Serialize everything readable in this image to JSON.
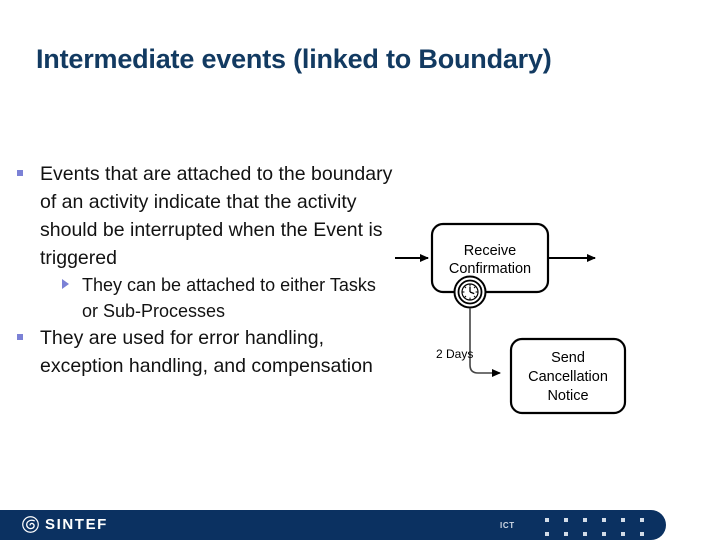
{
  "slide": {
    "title": "Intermediate events (linked to Boundary)",
    "title_color": "#123a61",
    "background_color": "#ffffff"
  },
  "body": {
    "bullets": [
      {
        "level": 1,
        "marker": "square-bullet",
        "text": "Events that are attached to the boundary of an activity indicate that the activity should be interrupted when the Event is triggered"
      },
      {
        "level": 2,
        "marker": "triangle-bullet",
        "text": "They can be attached to either Tasks or Sub-Processes"
      },
      {
        "level": 1,
        "marker": "square-bullet",
        "text": "They are used for error handling, exception handling, and compensation"
      }
    ],
    "bullet_color": "#7b81d6",
    "text_color": "#121212"
  },
  "diagram": {
    "type": "bpmn-process-fragment",
    "tasks": [
      {
        "id": "receive",
        "label_lines": [
          "Receive",
          "Confirmation"
        ]
      },
      {
        "id": "send",
        "label_lines": [
          "Send",
          "Cancellation",
          "Notice"
        ]
      }
    ],
    "boundary_event": {
      "attached_to": "receive",
      "event_type": "timer",
      "icon": "clock-icon"
    },
    "flow_labels": [
      {
        "id": "timer-flow",
        "text": "2 Days"
      }
    ],
    "incoming_arrow": true,
    "outgoing_arrow": true,
    "stroke_color": "#000000",
    "fill_color": "#ffffff"
  },
  "footer": {
    "bar_color": "#0b3161",
    "logo_text": "SINTEF",
    "logo_mark": "sintef-swirl-icon",
    "unit_text": "ICT",
    "dot_color": "#d4dde8",
    "dot_columns": 6,
    "dot_rows": 2
  }
}
